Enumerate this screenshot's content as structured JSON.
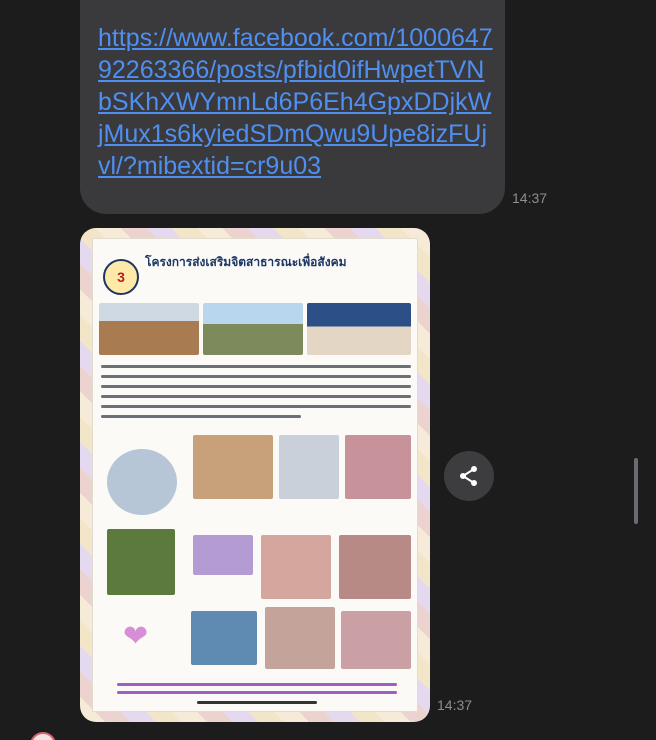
{
  "messages": [
    {
      "type": "link",
      "text": "https://www.facebook.com/100064792263366/posts/pfbid0ifHwpetTVNbSKhXWYmnLd6P6Eh4GpxDDjkWjMux1s6kyiedSDmQwu9Upe8izFUjvl/?mibextid=cr9u03",
      "time": "14:37"
    },
    {
      "type": "image",
      "poster": {
        "badge": "3",
        "title": "โครงการส่งเสริมจิตสาธารณะเพื่อสังคม"
      },
      "time": "14:37"
    }
  ],
  "icons": {
    "share": "share-icon",
    "heart": "heart-icon"
  },
  "colors": {
    "background": "#1c1c1d",
    "bubble": "#3a3a3c",
    "link": "#4f8ff2",
    "timestamp": "#8e8e92"
  }
}
